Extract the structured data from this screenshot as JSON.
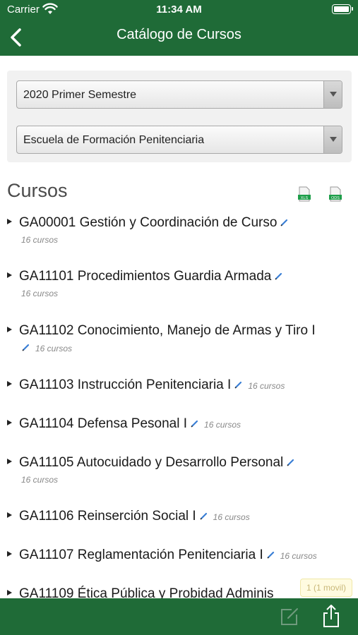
{
  "status_bar": {
    "carrier": "Carrier",
    "time": "11:34 AM"
  },
  "nav": {
    "title": "Catálogo de Cursos",
    "back_icon": "chevron-left-icon"
  },
  "filters": {
    "semester": {
      "selected": "2020 Primer Semestre"
    },
    "school": {
      "selected": "Escuela de Formación Penitenciaria"
    }
  },
  "section": {
    "title": "Cursos",
    "export_xls_label": "XLS",
    "export_ods_label": "ODS"
  },
  "courses": [
    {
      "code": "GA00001",
      "name": "Gestión y Coordinación de Curso",
      "count": "16 cursos"
    },
    {
      "code": "GA11101",
      "name": "Procedimientos Guardia Armada",
      "count": "16 cursos"
    },
    {
      "code": "GA11102",
      "name": "Conocimiento, Manejo de Armas y Tiro I",
      "count": "16 cursos"
    },
    {
      "code": "GA11103",
      "name": "Instrucción Penitenciaria I",
      "count": "16 cursos"
    },
    {
      "code": "GA11104",
      "name": "Defensa Pesonal I",
      "count": "16 cursos"
    },
    {
      "code": "GA11105",
      "name": "Autocuidado y Desarrollo Personal",
      "count": "16 cursos"
    },
    {
      "code": "GA11106",
      "name": "Reinserción Social I",
      "count": "16 cursos"
    },
    {
      "code": "GA11107",
      "name": "Reglamentación Penitenciaria I",
      "count": "16 cursos"
    },
    {
      "code": "GA11109",
      "name": "Ética Pública y Probidad Adminis",
      "count": ""
    }
  ],
  "badge": {
    "text": "1 (1 movil)"
  },
  "colors": {
    "brand_green": "#1f6b37",
    "pencil_blue": "#3a7fd5"
  }
}
